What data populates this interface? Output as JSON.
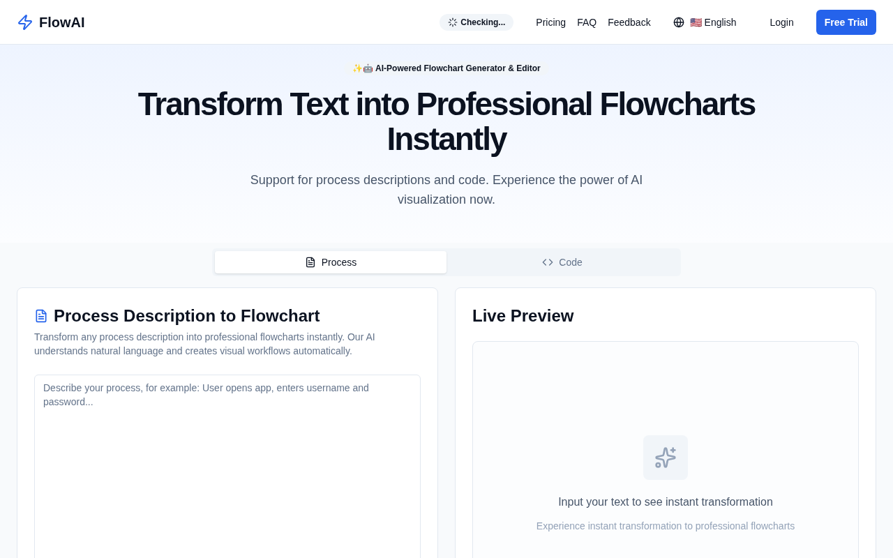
{
  "header": {
    "brand": "FlowAI",
    "status": "Checking...",
    "nav": [
      "Pricing",
      "FAQ",
      "Feedback"
    ],
    "language": "🇺🇸 English",
    "login": "Login",
    "cta": "Free Trial"
  },
  "hero": {
    "badge": "✨🤖 AI-Powered Flowchart Generator & Editor",
    "title": "Transform Text into Professional Flowcharts Instantly",
    "subtitle": "Support for process descriptions and code. Experience the power of AI visualization now."
  },
  "tabs": [
    {
      "label": "Process",
      "kind": "document",
      "selected": true
    },
    {
      "label": "Code",
      "kind": "code",
      "selected": false
    }
  ],
  "input_panel": {
    "title": "Process Description to Flowchart",
    "description": "Transform any process description into professional flowcharts instantly. Our AI understands natural language and creates visual workflows automatically.",
    "placeholder": "Describe your process, for example: User opens app, enters username and password..."
  },
  "preview_panel": {
    "title": "Live Preview",
    "empty_title": "Input your text to see instant transformation",
    "empty_subtitle": "Experience instant transformation to professional flowcharts"
  }
}
